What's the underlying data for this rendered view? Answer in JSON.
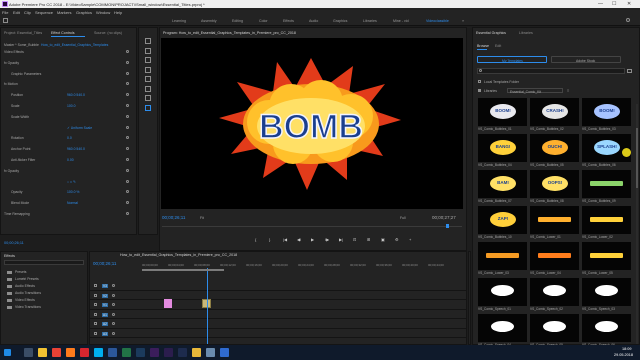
{
  "window": {
    "title": "Adobe Premiere Pro CC 2018 - E:\\VideoSample\\COMMON\\PROJACT\\\\Small_window\\Essential_Titles.prproj *",
    "min": "—",
    "max": "☐",
    "close": "✕"
  },
  "menu": [
    "File",
    "Edit",
    "Clip",
    "Sequence",
    "Markers",
    "Graphics",
    "Window",
    "Help"
  ],
  "workspaces": [
    "Learning",
    "Assembly",
    "Editing",
    "Color",
    "Effects",
    "Audio",
    "Graphics",
    "Libraries",
    "Mine - vid",
    "Videoclassible"
  ],
  "source_panel": {
    "tabs": [
      "Project: Essential_Titles",
      "Effect Controls",
      "Source: (no clips)"
    ],
    "master_clip": "Master * Some_Bubble",
    "sequence_link": "How_to_edit_Essential_Graphics_Templates",
    "sections": [
      {
        "label": "Video Effects",
        "value": ""
      },
      {
        "label": "fx Opacity",
        "value": ""
      },
      {
        "label": "Graphic Parameters",
        "value": ""
      },
      {
        "label": "fx Motion",
        "value": ""
      },
      {
        "label": "Position",
        "value": "960.0   540.0"
      },
      {
        "label": "Scale",
        "value": "100.0"
      },
      {
        "label": "Scale Width",
        "value": ""
      },
      {
        "label": "",
        "value": "✓ Uniform Scale"
      },
      {
        "label": "Rotation",
        "value": "0.0"
      },
      {
        "label": "Anchor Point",
        "value": "960.0   540.0"
      },
      {
        "label": "Anti-flicker Filter",
        "value": "0.00"
      },
      {
        "label": "fx Opacity",
        "value": ""
      },
      {
        "label": "",
        "value": "○ □ ✎"
      },
      {
        "label": "Opacity",
        "value": "100.0 %"
      },
      {
        "label": "Blend Mode",
        "value": "Normal"
      },
      {
        "label": "Time Remapping",
        "value": ""
      }
    ],
    "timecode": "00;00;26;11"
  },
  "program_monitor": {
    "title": "Program: How_to_edit_Essential_Graphics_Templates_in_Premiere_pro_CC_2018",
    "current_time": "00;00;26;11",
    "fit": "Fit",
    "quality": "Full",
    "duration": "00;00;27;27",
    "bomb_text": "BOMB"
  },
  "transport": [
    "{",
    "}",
    "|◀",
    "◀I",
    "▶",
    "I▶",
    "▶|",
    "⊡",
    "⊞",
    "▣",
    "⚙",
    "+"
  ],
  "project_panel": {
    "title": "Effects",
    "items": [
      "Presets",
      "Lumetri Presets",
      "Audio Effects",
      "Audio Transitions",
      "Video Effects",
      "Video Transitions"
    ]
  },
  "timeline": {
    "sequence_tab": "How_to_edit_Essential_Graphics_Templates_in_Premiere_pro_CC_2018",
    "timecode": "00;00;26;11",
    "ruler": [
      "00;00;00;00",
      "00;00;04;00",
      "00;00;08;00",
      "00;00;12;00",
      "00;00;16;00",
      "00;00;20;00",
      "00;00;24;00",
      "00;00;28;00",
      "00;00;32;00",
      "00;00;36;00",
      "00;00;40;00",
      "00;00;44;00"
    ],
    "tracks": [
      "V3",
      "V2",
      "V1",
      "A1",
      "A2",
      "A3"
    ]
  },
  "essential_graphics": {
    "tabs": [
      "Essential Graphics",
      "Libraries"
    ],
    "subtabs": [
      "Browse",
      "Edit"
    ],
    "my_templates": "My Templates",
    "adobe_stock": "Adobe Stock",
    "local_folder": "Local Templates Folder",
    "libraries_label": "Libraries",
    "library_value": "Essential_Comic_Kit",
    "templates": [
      "VS_Comic_Bubbles_01",
      "VS_Comic_Bubbles_02",
      "VS_Comic_Bubbles_03",
      "VS_Comic_Bubbles_04",
      "VS_Comic_Bubbles_05",
      "VS_Comic_Bubbles_06",
      "VS_Comic_Bubbles_07",
      "VS_Comic_Bubbles_08",
      "VS_Comic_Bubbles_09",
      "VS_Comic_Bubbles_10",
      "VS_Comic_Lower_01",
      "VS_Comic_Lower_02",
      "VS_Comic_Lower_03",
      "VS_Comic_Lower_04",
      "VS_Comic_Lower_05",
      "VS_Comic_Speech_01",
      "VS_Comic_Speech_02",
      "VS_Comic_Speech_03",
      "VS_Comic_Speech_04",
      "VS_Comic_Speech_05",
      "VS_Comic_Speech_06"
    ],
    "thumb_words": [
      "BOOM!",
      "CRASH!",
      "BOOM!",
      "BANG!",
      "OUCH!",
      "SPLASH!",
      "BAM!",
      "OOPS!",
      "",
      "ZAP!",
      "",
      "",
      "",
      "",
      "",
      "",
      "",
      "",
      "",
      "",
      ""
    ]
  },
  "taskbar": {
    "time": "18:09",
    "date": "29.05.2018"
  },
  "colors": {
    "accent": "#2d8ceb",
    "bomb_fill": "#ffd13a",
    "bomb_text": "#1b3f8f"
  }
}
